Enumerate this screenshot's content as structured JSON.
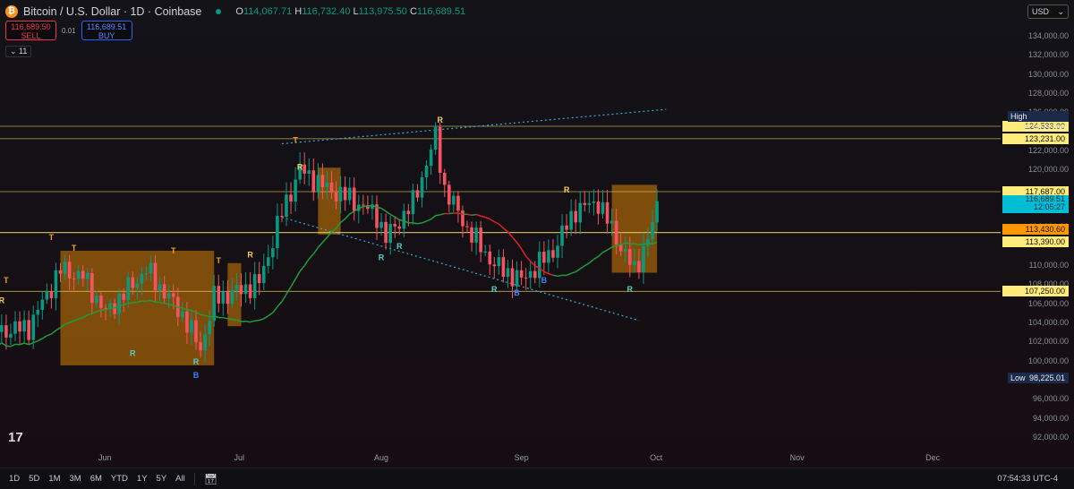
{
  "header": {
    "symbol_icon": "bitcoin-icon",
    "title": "Bitcoin / U.S. Dollar · 1D · Coinbase",
    "o_label": "O",
    "o": "114,067.71",
    "h_label": "H",
    "h": "116,732.40",
    "l_label": "L",
    "l": "113,975.50",
    "c_label": "C",
    "c": "116,689.51"
  },
  "trade": {
    "sell_price": "116,689.50",
    "sell_label": "SELL",
    "spread": "0.01",
    "buy_price": "116,689.51",
    "buy_label": "BUY"
  },
  "indicators_toggle": "11",
  "currency": "USD",
  "price_axis": {
    "ticks": [
      "134,000.00",
      "132,000.00",
      "130,000.00",
      "128,000.00",
      "126,000.00",
      "122,000.00",
      "120,000.00",
      "114,000.00",
      "110,000.00",
      "108,000.00",
      "106,000.00",
      "104,000.00",
      "102,000.00",
      "100,000.00",
      "96,000.00",
      "94,000.00",
      "92,000.00"
    ],
    "tags": [
      {
        "label": "124,533.00",
        "price": 124533,
        "bg": "#ffeb7a"
      },
      {
        "label": "123,231.00",
        "price": 123231,
        "bg": "#ffeb7a"
      },
      {
        "label": "117,687.00",
        "price": 117687,
        "bg": "#ffeb7a"
      },
      {
        "label": "113,430.60",
        "price": 113700,
        "bg": "#ff9800"
      },
      {
        "label": "113,390.00",
        "price": 112450,
        "bg": "#ffeb7a"
      },
      {
        "label": "107,250.00",
        "price": 107250,
        "bg": "#ffeb7a"
      }
    ],
    "high_label": "High",
    "high": "124,533.00",
    "low_label": "Low",
    "low": "98,225.01",
    "last_price": "116,689.51",
    "countdown": "12:05:27",
    "last_color": "#00bcd4"
  },
  "time_axis": {
    "labels": [
      {
        "t": "Jun",
        "d": "2025-06-01"
      },
      {
        "t": "Jul",
        "d": "2025-07-01"
      },
      {
        "t": "Aug",
        "d": "2025-08-01"
      },
      {
        "t": "Sep",
        "d": "2025-09-01"
      },
      {
        "t": "Oct",
        "d": "2025-10-01"
      },
      {
        "t": "Nov",
        "d": "2025-11-01"
      },
      {
        "t": "Dec",
        "d": "2025-12-01"
      }
    ]
  },
  "bottom": {
    "ranges": [
      "1D",
      "5D",
      "1M",
      "3M",
      "6M",
      "YTD",
      "1Y",
      "5Y",
      "All"
    ],
    "date_range_icon": "calendar-range-icon",
    "clock": "07:54:33 UTC-4"
  },
  "colors": {
    "up": "#089981",
    "down": "#f7525f",
    "ma": "#1f9d3a",
    "ma_down": "#e01e2a",
    "zone": "#ff9800",
    "level": "#e6c95a",
    "trend": "#2ab0d8"
  },
  "chart_data": {
    "type": "candlestick",
    "title": "Bitcoin / U.S. Dollar · 1D · Coinbase",
    "ylim": [
      90000,
      136000
    ],
    "xrange": [
      "2025-05-08",
      "2025-12-20"
    ],
    "close_keypoints": [
      [
        "2025-05-08",
        103000
      ],
      [
        "2025-05-15",
        103500
      ],
      [
        "2025-05-22",
        109500
      ],
      [
        "2025-05-27",
        108800
      ],
      [
        "2025-06-01",
        105000
      ],
      [
        "2025-06-10",
        109500
      ],
      [
        "2025-06-18",
        104800
      ],
      [
        "2025-06-22",
        101200
      ],
      [
        "2025-06-25",
        106500
      ],
      [
        "2025-06-30",
        107200
      ],
      [
        "2025-07-05",
        108200
      ],
      [
        "2025-07-10",
        115500
      ],
      [
        "2025-07-14",
        120000
      ],
      [
        "2025-07-20",
        118000
      ],
      [
        "2025-07-25",
        117000
      ],
      [
        "2025-07-31",
        115200
      ],
      [
        "2025-08-02",
        112800
      ],
      [
        "2025-08-08",
        116500
      ],
      [
        "2025-08-13",
        123400
      ],
      [
        "2025-08-15",
        118000
      ],
      [
        "2025-08-20",
        113800
      ],
      [
        "2025-08-26",
        110000
      ],
      [
        "2025-09-01",
        108400
      ],
      [
        "2025-09-08",
        111500
      ],
      [
        "2025-09-13",
        115800
      ],
      [
        "2025-09-18",
        116600
      ],
      [
        "2025-09-22",
        112800
      ],
      [
        "2025-09-26",
        109400
      ],
      [
        "2025-09-30",
        114000
      ],
      [
        "2025-10-01",
        116689.51
      ]
    ],
    "levels": [
      124533,
      123231,
      117687,
      113430.6,
      113390,
      107250
    ],
    "trendlines": [
      {
        "from": [
          "2025-07-10",
          122700
        ],
        "to": [
          "2025-10-03",
          126300
        ]
      },
      {
        "from": [
          "2025-07-10",
          115000
        ],
        "to": [
          "2025-09-27",
          104200
        ]
      }
    ],
    "zones": [
      {
        "from": "2025-05-22",
        "to": "2025-06-25",
        "low": 99500,
        "high": 111500
      },
      {
        "from": "2025-06-28",
        "to": "2025-07-01",
        "low": 103600,
        "high": 110200
      },
      {
        "from": "2025-07-18",
        "to": "2025-07-23",
        "low": 113200,
        "high": 120200
      },
      {
        "from": "2025-09-21",
        "to": "2025-10-01",
        "low": 109200,
        "high": 118400
      }
    ],
    "markers": [
      {
        "t": "R",
        "d": "2025-05-09",
        "p": 106000,
        "c": "#f0d060"
      },
      {
        "t": "T",
        "d": "2025-05-10",
        "p": 108100,
        "c": "#f0a030"
      },
      {
        "t": "T",
        "d": "2025-05-20",
        "p": 112600,
        "c": "#f0a030"
      },
      {
        "t": "T",
        "d": "2025-05-25",
        "p": 111500,
        "c": "#f0a030"
      },
      {
        "t": "R",
        "d": "2025-06-07",
        "p": 100500,
        "c": "#4dd0c0"
      },
      {
        "t": "T",
        "d": "2025-06-16",
        "p": 111200,
        "c": "#f0a030"
      },
      {
        "t": "R",
        "d": "2025-06-21",
        "p": 99600,
        "c": "#4dd0c0"
      },
      {
        "t": "B",
        "d": "2025-06-21",
        "p": 98200,
        "c": "#3f7fff"
      },
      {
        "t": "T",
        "d": "2025-06-26",
        "p": 110200,
        "c": "#f0a030"
      },
      {
        "t": "R",
        "d": "2025-07-03",
        "p": 110800,
        "c": "#f0d060"
      },
      {
        "t": "T",
        "d": "2025-07-13",
        "p": 122800,
        "c": "#f0a030"
      },
      {
        "t": "R",
        "d": "2025-07-14",
        "p": 120000,
        "c": "#f0d060"
      },
      {
        "t": "R",
        "d": "2025-08-01",
        "p": 110500,
        "c": "#4dd0c0"
      },
      {
        "t": "R",
        "d": "2025-08-05",
        "p": 111700,
        "c": "#4dd0c0"
      },
      {
        "t": "R",
        "d": "2025-08-14",
        "p": 124900,
        "c": "#f0d060"
      },
      {
        "t": "R",
        "d": "2025-08-26",
        "p": 107200,
        "c": "#4dd0c0"
      },
      {
        "t": "B",
        "d": "2025-08-31",
        "p": 106800,
        "c": "#3f7fff"
      },
      {
        "t": "B",
        "d": "2025-09-06",
        "p": 108100,
        "c": "#3f7fff"
      },
      {
        "t": "R",
        "d": "2025-09-11",
        "p": 117600,
        "c": "#f0d060"
      },
      {
        "t": "R",
        "d": "2025-09-25",
        "p": 107200,
        "c": "#4dd0c0"
      }
    ]
  }
}
